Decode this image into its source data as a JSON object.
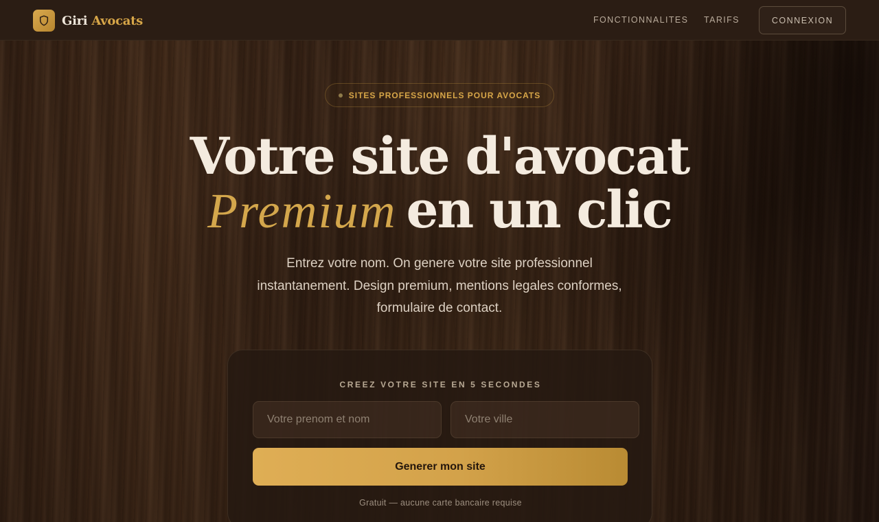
{
  "nav": {
    "brand_part1": "Giri",
    "brand_part2": "Avocats",
    "links": [
      "FONCTIONNALITES",
      "TARIFS"
    ],
    "login": "CONNEXION",
    "logo_icon": "shield-icon"
  },
  "hero": {
    "eyebrow": "SITES PROFESSIONNELS POUR AVOCATS",
    "title_line1": "Votre site d'avocat",
    "title_accent": "Premium",
    "title_line2_rest": "en un clic",
    "subtitle": "Entrez votre nom. On genere votre site professionnel instantanement. Design premium, mentions legales conformes, formulaire de contact."
  },
  "form": {
    "label": "CREEZ VOTRE SITE EN 5 SECONDES",
    "name_placeholder": "Votre prenom et nom",
    "city_placeholder": "Votre ville",
    "submit": "Generer mon site",
    "note": "Gratuit — aucune carte bancaire requise"
  },
  "colors": {
    "accent_gold": "#d7a648",
    "background_wood": "#3a2416",
    "nav_bg": "#2b1d14"
  }
}
